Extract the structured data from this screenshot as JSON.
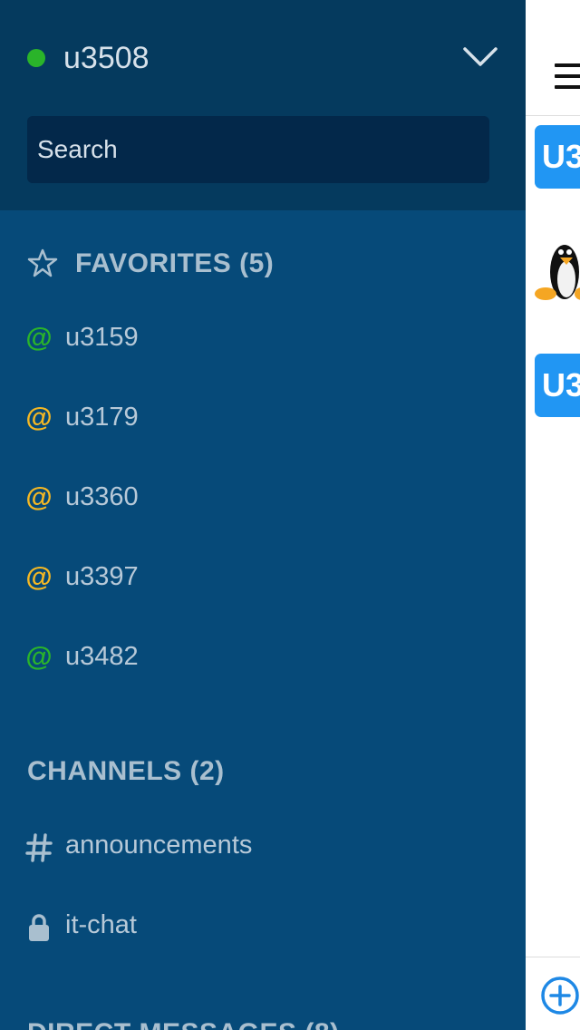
{
  "header": {
    "username": "u3508",
    "search_placeholder": "Search"
  },
  "favorites": {
    "title": "FAVORITES (5)",
    "items": [
      {
        "label": "u3159",
        "status": "online"
      },
      {
        "label": "u3179",
        "status": "away"
      },
      {
        "label": "u3360",
        "status": "away"
      },
      {
        "label": "u3397",
        "status": "away"
      },
      {
        "label": "u3482",
        "status": "online"
      }
    ]
  },
  "channels": {
    "title": "CHANNELS (2)",
    "items": [
      {
        "label": "announcements",
        "icon": "hash-icon"
      },
      {
        "label": "it-chat",
        "icon": "lock-icon"
      }
    ]
  },
  "direct_messages": {
    "title": "DIRECT MESSAGES (8)"
  },
  "main": {
    "avatar_initials_1": "U3",
    "avatar_initials_2": "U3"
  },
  "colors": {
    "sidebar_bg": "#064a79",
    "header_bg": "#053a5e",
    "online": "#2ab42a",
    "away": "#f5b823",
    "avatar_blue": "#2196f3"
  }
}
